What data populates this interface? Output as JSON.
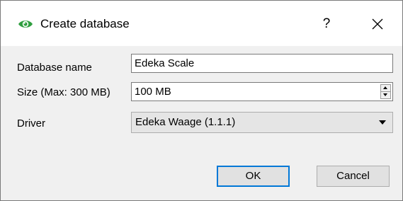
{
  "dialog": {
    "title": "Create database",
    "help_label": "?",
    "icon": "eye-icon",
    "accent_color": "#2e9e3e"
  },
  "form": {
    "name_label": "Database name",
    "name_value": "Edeka Scale",
    "size_label": "Size (Max: 300 MB)",
    "size_value": "100 MB",
    "driver_label": "Driver",
    "driver_value": "Edeka Waage (1.1.1)"
  },
  "buttons": {
    "ok_label": "OK",
    "cancel_label": "Cancel",
    "ok_focus_color": "#0078d7"
  }
}
